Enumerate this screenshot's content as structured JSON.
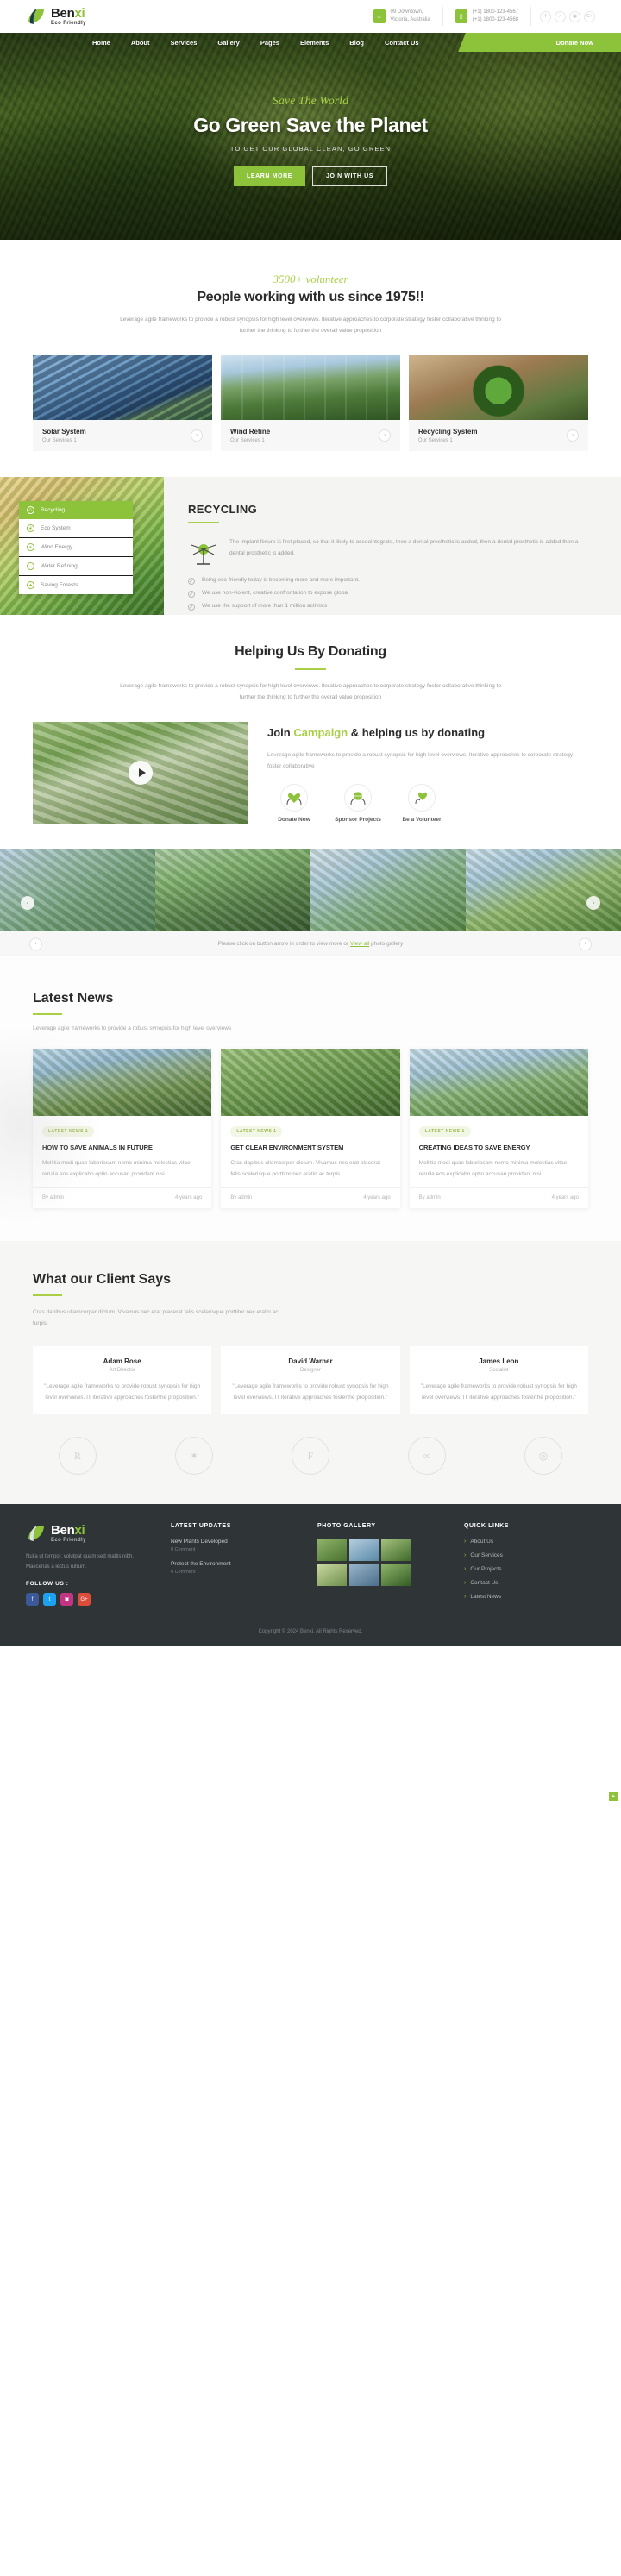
{
  "header": {
    "logo_name_a": "Ben",
    "logo_name_b": "xi",
    "logo_sub": "Eco Friendly",
    "address_line1": "09 Downtown,",
    "address_line2": "Victoria, Australia",
    "phone_line1": "(+1) 1800-123-4567",
    "phone_line2": "(+1) 1800-123-4568",
    "address_icon": "home-icon",
    "phone_icon": "mobile-icon",
    "socials": [
      {
        "name": "facebook-icon",
        "glyph": "f"
      },
      {
        "name": "twitter-icon",
        "glyph": "✓"
      },
      {
        "name": "instagram-icon",
        "glyph": "▣"
      },
      {
        "name": "google-plus-icon",
        "glyph": "G+"
      }
    ]
  },
  "nav": {
    "items": [
      "Home",
      "About",
      "Services",
      "Gallery",
      "Pages",
      "Elements",
      "Blog",
      "Contact Us"
    ],
    "cta": "Donate Now"
  },
  "hero": {
    "eyebrow": "Save The World",
    "title": "Go Green Save the Planet",
    "subtitle": "TO GET OUR GLOBAL CLEAN, GO GREEN",
    "btn_primary": "LEARN MORE",
    "btn_secondary": "JOIN WITH US"
  },
  "services": {
    "eyebrow": "3500+ volunteer",
    "title": "People working with us since 1975!!",
    "desc": "Leverage agile frameworks to provide a robust synopsis for high level overviews. Iterative approaches to corporate strategy foster collaborative thinking to further the thinking to further the overall value proposition",
    "cards": [
      {
        "title": "Solar System",
        "subtitle": "Our Services 1"
      },
      {
        "title": "Wind Refine",
        "subtitle": "Our Services 1"
      },
      {
        "title": "Recycling System",
        "subtitle": "Our Services 1"
      }
    ],
    "arrow": "›"
  },
  "recycling": {
    "tabs": [
      {
        "label": "Recycling",
        "icon": "recycle-icon",
        "active": true
      },
      {
        "label": "Eco System",
        "icon": "leaf-icon",
        "active": false
      },
      {
        "label": "Wind Energy",
        "icon": "bulb-icon",
        "active": false
      },
      {
        "label": "Water Refining",
        "icon": "drop-icon",
        "active": false
      },
      {
        "label": "Saving Forests",
        "icon": "tree-icon",
        "active": false
      }
    ],
    "heading": "RECYCLING",
    "paragraph": "The implant fixture is first placed, so that it likely to osseointegrate, then a dental prosthetic is added, then a dental prosthetic is added then a dental prosthetic is added.",
    "bullets": [
      "Being eco-friendly today is becoming more and more important.",
      "We use non-violent, creative confrontation to expose global",
      "We use the support of more than 1 million activists"
    ]
  },
  "donating": {
    "title": "Helping Us By Donating",
    "desc": "Leverage agile frameworks to provide a robust synopsis for high level overviews. Iterative approaches to corporate strategy foster collaborative thinking to further the thinking to further the overall value proposition",
    "heading_a": "Join ",
    "heading_hl": "Campaign",
    "heading_b": " & helping us by donating",
    "paragraph": "Leverage agile frameworks to provide a robust synopsis for high level overviews. Iterative approaches to corporate strategy foster collaborative",
    "options": [
      {
        "label": "Donate Now",
        "icon": "hands-heart-icon"
      },
      {
        "label": "Sponsor Projects",
        "icon": "hands-globe-icon"
      },
      {
        "label": "Be a Volunteer",
        "icon": "hand-heart-icon"
      }
    ],
    "play_icon": "play-icon"
  },
  "gallery": {
    "caption_pre": "Please click on button arrow in order to view more or ",
    "caption_link": "View all",
    "caption_post": " photo gallery",
    "prev": "‹",
    "next": "›"
  },
  "news": {
    "title": "Latest News",
    "subtitle": "Leverage agile frameworks to provide a robust synopsis for high level overviews",
    "cards": [
      {
        "tag": "LATEST NEWS 1",
        "title": "HOW TO SAVE ANIMALS IN FUTURE",
        "excerpt": "Mollitia modi quae laboriosam nemo minima molestias vitae rerulla eos explicabo optio accusan provident nisi ...",
        "author": "By admin",
        "date": "4 years ago"
      },
      {
        "tag": "LATEST NEWS 1",
        "title": "GET CLEAR ENVIRONMENT SYSTEM",
        "excerpt": "Cras dapibus ullamcorper dictum. Vivamus nec erat placerat felis scelerisque porttitor nec eratin ac turpis.",
        "author": "By admin",
        "date": "4 years ago"
      },
      {
        "tag": "LATEST NEWS 1",
        "title": "CREATING IDEAS TO SAVE ENERGY",
        "excerpt": "Mollitia modi quae laboriosam nemo minima molestias vitae rerulla eos explicabo optio accusan provident nisi ...",
        "author": "By admin",
        "date": "4 years ago"
      }
    ]
  },
  "testimonials": {
    "title": "What our Client Says",
    "subtitle": "Cras dapibus ullamcorper dictum. Vivamus nec erat placerat felis scelerisque porttitor nec eratin ac turpis.",
    "items": [
      {
        "name": "Adam Rose",
        "role": "Art Director",
        "quote": "\"Leverage agile frameworks to provide robust synopsis for high level overviews. IT iterative approaches fosterthe proposition.\""
      },
      {
        "name": "David Warner",
        "role": "Designer",
        "quote": "\"Leverage agile frameworks to provide robust synopsis for high level overviews. IT iterative approaches fosterthe proposition.\""
      },
      {
        "name": "James Leon",
        "role": "Socialist",
        "quote": "\"Leverage agile frameworks to provide robust synopsis for high level overviews. IT iterative approaches fosterthe proposition.\""
      }
    ],
    "brands": [
      "R",
      "✶",
      "F",
      "∞",
      "◎"
    ]
  },
  "footer": {
    "logo_name_a": "Ben",
    "logo_name_b": "xi",
    "logo_sub": "Eco Friendly",
    "about": "Nulla ut tempor, volutpat quam sed mattis nibh. Maecenas a lectus rutrum.",
    "follow_label": "FOLLOW US :",
    "socials": [
      {
        "name": "facebook-icon",
        "glyph": "f",
        "color": "#3b5998"
      },
      {
        "name": "twitter-icon",
        "glyph": "t",
        "color": "#1da1f2"
      },
      {
        "name": "instagram-icon",
        "glyph": "▣",
        "color": "#c13584"
      },
      {
        "name": "google-plus-icon",
        "glyph": "G+",
        "color": "#dd4b39"
      }
    ],
    "latest_title": "LATEST UPDATES",
    "latest": [
      {
        "title": "New Plants Developed",
        "meta": "0 Comment"
      },
      {
        "title": "Protect the Environment",
        "meta": "0 Comment"
      }
    ],
    "gallery_title": "PHOTO GALLERY",
    "links_title": "QUICK LINKS",
    "links": [
      "About Us",
      "Our Services",
      "Our Projects",
      "Contact Us",
      "Latest News"
    ],
    "copyright": "Copyright © 2024 Benxi. All Rights Reserved."
  },
  "scroll_top": "▲"
}
